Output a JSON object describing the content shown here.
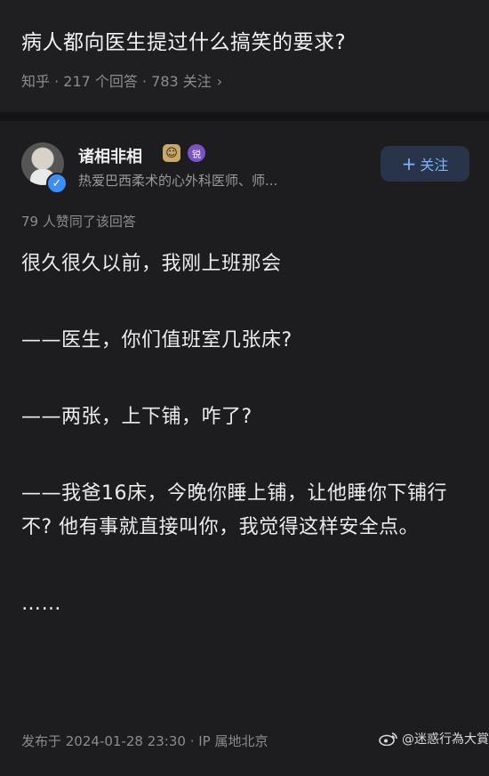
{
  "question": {
    "title": "病人都向医生提过什么搞笑的要求?",
    "meta": "知乎 · 217 个回答 · 783 关注",
    "chevron": "›"
  },
  "author": {
    "name": "诸相非相",
    "bio": "热爱巴西柔术的心外科医师、师...",
    "verify_icon": "✓",
    "badge1": "☺",
    "badge2": "锐",
    "follow_plus": "+",
    "follow_label": "关注"
  },
  "answer": {
    "upvotes": "79 人赞同了该回答",
    "paragraphs": [
      "很久很久以前，我刚上班那会",
      "——医生，你们值班室几张床?",
      "——两张，上下铺，咋了?",
      "——我爸16床，今晚你睡上铺，让他睡你下铺行不? 他有事就直接叫你，我觉得这样安全点。",
      "……"
    ],
    "post_date": "发布于 2024-01-28 23:30 · IP 属地北京"
  },
  "watermark": {
    "text": "@迷惑行為大賞",
    "icon": "weibo-logo"
  },
  "colors": {
    "background": "#1d1d1f",
    "accent": "#7fb2ff",
    "follow_bg": "#283449",
    "verify": "#3a8ef6"
  }
}
